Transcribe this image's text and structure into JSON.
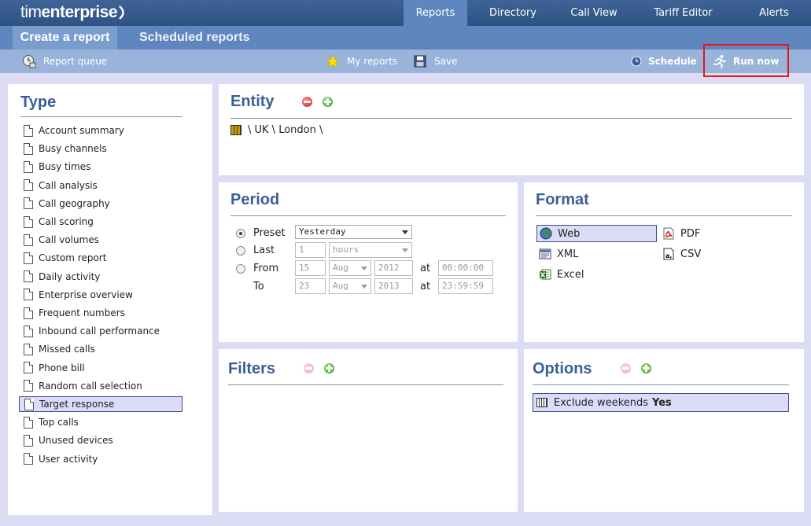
{
  "app": {
    "logo_light": "tim",
    "logo_bold": "enterprise"
  },
  "nav": [
    "Reports",
    "Directory",
    "Call View",
    "Tariff Editor",
    "Alerts"
  ],
  "subnav": {
    "active": "Create a report",
    "other": "Scheduled reports"
  },
  "toolbar": {
    "report_queue": "Report queue",
    "my_reports": "My reports",
    "save": "Save",
    "schedule": "Schedule",
    "run_now": "Run now"
  },
  "type": {
    "title": "Type",
    "items": [
      "Account summary",
      "Busy channels",
      "Busy times",
      "Call analysis",
      "Call geography",
      "Call scoring",
      "Call volumes",
      "Custom report",
      "Daily activity",
      "Enterprise overview",
      "Frequent numbers",
      "Inbound call performance",
      "Missed calls",
      "Phone bill",
      "Random call selection",
      "Target response",
      "Top calls",
      "Unused devices",
      "User activity"
    ],
    "selected": "Target response"
  },
  "entity": {
    "title": "Entity",
    "path": "\\ UK \\ London \\"
  },
  "period": {
    "title": "Period",
    "preset_label": "Preset",
    "preset_value": "Yesterday",
    "last_label": "Last",
    "last_value": "1",
    "last_unit": "hours",
    "from_label": "From",
    "from_day": "15",
    "from_month": "Aug",
    "from_year": "2012",
    "from_time": "00:00:00",
    "to_label": "To",
    "to_day": "23",
    "to_month": "Aug",
    "to_year": "2013",
    "to_time": "23:59:59",
    "at_label": "at",
    "selected": "preset"
  },
  "format": {
    "title": "Format",
    "items": [
      "Web",
      "PDF",
      "XML",
      "CSV",
      "Excel"
    ],
    "selected": "Web"
  },
  "filters": {
    "title": "Filters"
  },
  "options": {
    "title": "Options",
    "row_label": "Exclude weekends",
    "row_value": "Yes"
  },
  "colors": {
    "header": "#2f5285",
    "accent": "#3a5f96",
    "highlight": "#e01818"
  }
}
